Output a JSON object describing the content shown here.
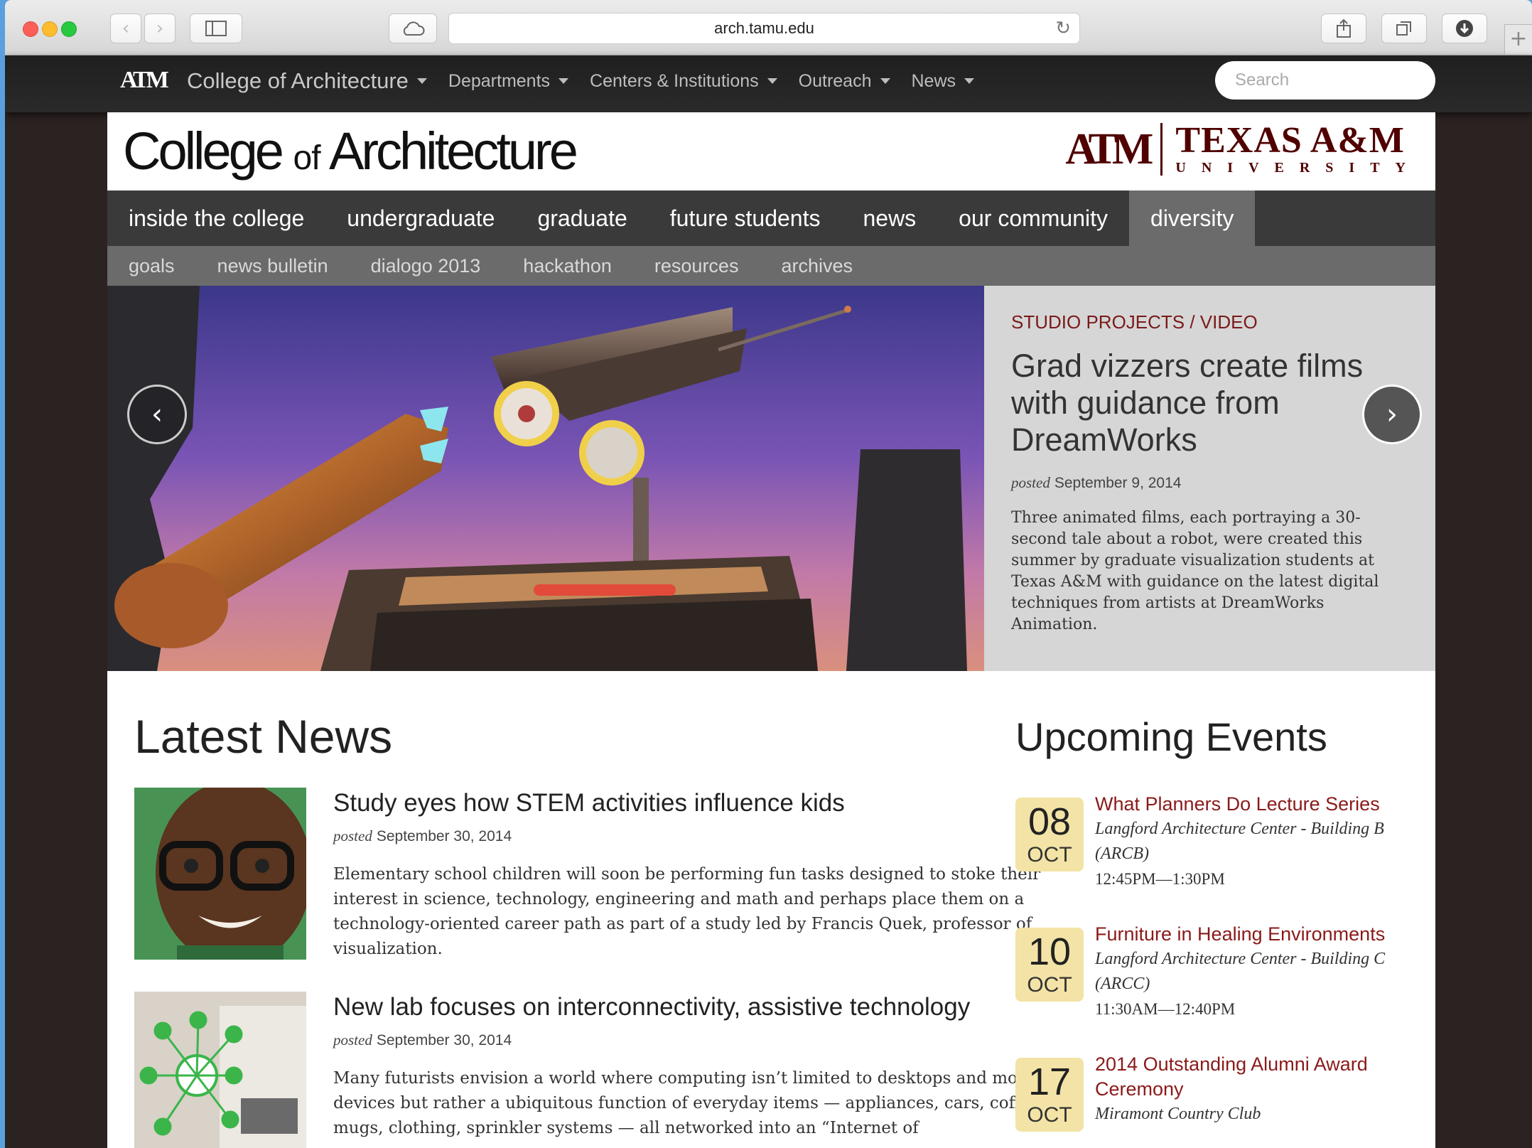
{
  "browser": {
    "url": "arch.tamu.edu"
  },
  "topbar": {
    "logo": "ATM",
    "items": [
      {
        "label": "College of Architecture"
      },
      {
        "label": "Departments"
      },
      {
        "label": "Centers & Institutions"
      },
      {
        "label": "Outreach"
      },
      {
        "label": "News"
      }
    ],
    "search_placeholder": "Search"
  },
  "header": {
    "college": "College",
    "of": "of",
    "architecture": "Architecture",
    "tamu_mark": "ATM",
    "tamu_name": "TEXAS A&M",
    "tamu_sub": "UNIVERSITY"
  },
  "mainnav": [
    "inside the college",
    "undergraduate",
    "graduate",
    "future students",
    "news",
    "our community",
    "diversity"
  ],
  "subnav": [
    "goals",
    "news bulletin",
    "dialogo 2013",
    "hackathon",
    "resources",
    "archives"
  ],
  "hero": {
    "category": "STUDIO PROJECTS / VIDEO",
    "title": "Grad vizzers create films with guidance from DreamWorks",
    "posted_label": "posted",
    "date": "September 9, 2014",
    "text": "Three animated films, each portraying a 30-second tale about a robot, were created this summer by graduate visualization students at Texas A&M with guidance on the latest digital techniques from artists at DreamWorks Animation."
  },
  "news": {
    "heading": "Latest News",
    "stories": [
      {
        "title": "Study eyes how STEM activities influence kids",
        "posted_label": "posted",
        "date": "September 30, 2014",
        "text": "Elementary school children will soon be performing fun tasks designed to stoke their interest in science, technology, engineering and math and perhaps place them on a technology-oriented career path as part of a study led by Francis Quek, professor of visualization."
      },
      {
        "title": "New lab focuses on interconnectivity, assistive technology",
        "posted_label": "posted",
        "date": "September 30, 2014",
        "text": "Many futurists envision a world where computing isn’t limited to desktops and mobile devices but rather a ubiquitous function of everyday items — appliances, cars, coffee mugs, clothing, sprinkler systems — all networked into an “Internet of"
      }
    ]
  },
  "events": {
    "heading": "Upcoming Events",
    "items": [
      {
        "day": "08",
        "month": "OCT",
        "title": "What Planners Do Lecture Series",
        "location": "Langford Architecture Center - Building B (ARCB)",
        "time": "12:45PM—1:30PM"
      },
      {
        "day": "10",
        "month": "OCT",
        "title": "Furniture in Healing Environments",
        "location": "Langford Architecture Center - Building C (ARCC)",
        "time": "11:30AM—12:40PM"
      },
      {
        "day": "17",
        "month": "OCT",
        "title": "2014 Outstanding Alumni Award Ceremony",
        "location": "Miramont Country Club",
        "time": ""
      }
    ]
  }
}
